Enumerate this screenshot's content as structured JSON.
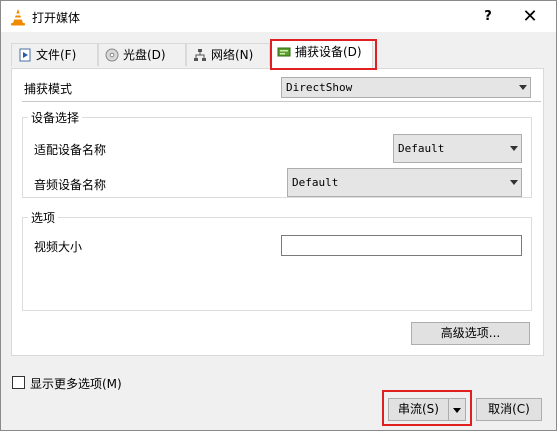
{
  "window": {
    "title": "打开媒体",
    "help_label": "?",
    "close_label": "✕"
  },
  "tabs": [
    {
      "label": "文件(F)",
      "icon": "file-icon"
    },
    {
      "label": "光盘(D)",
      "icon": "disc-icon"
    },
    {
      "label": "网络(N)",
      "icon": "network-icon"
    },
    {
      "label": "捕获设备(D)",
      "icon": "capture-card-icon",
      "active": true
    }
  ],
  "capture": {
    "mode_label": "捕获模式",
    "mode_value": "DirectShow",
    "device_group_title": "设备选择",
    "video_device_label": "适配设备名称",
    "video_device_value": "Default",
    "audio_device_label": "音频设备名称",
    "audio_device_value": "Default",
    "options_group_title": "选项",
    "video_size_label": "视频大小",
    "video_size_value": "",
    "advanced_button": "高级选项..."
  },
  "footer": {
    "show_more_label": "显示更多选项(M)",
    "show_more_checked": false,
    "stream_button": "串流(S)",
    "cancel_button": "取消(C)"
  },
  "colors": {
    "highlight": "#e02020",
    "vlc_orange": "#f08a00"
  }
}
